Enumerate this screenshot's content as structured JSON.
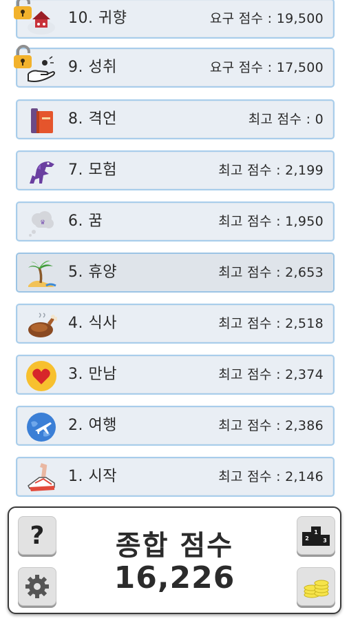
{
  "levels": [
    {
      "name": "10. 귀향",
      "score": "요구 점수 : 19,500",
      "locked": true,
      "icon": "home-return-icon"
    },
    {
      "name": "9. 성취",
      "score": "요구 점수 : 17,500",
      "locked": true,
      "icon": "hand-achievement-icon"
    },
    {
      "name": "8. 격언",
      "score": "최고 점수 : 0",
      "locked": false,
      "icon": "book-icon"
    },
    {
      "name": "7. 모험",
      "score": "최고 점수 : 2,199",
      "locked": false,
      "icon": "dragon-icon"
    },
    {
      "name": "6. 꿈",
      "score": "최고 점수 : 1,950",
      "locked": false,
      "icon": "dream-cloud-icon"
    },
    {
      "name": "5. 휴양",
      "score": "최고 점수 : 2,653",
      "locked": false,
      "icon": "palm-island-icon",
      "selected": true
    },
    {
      "name": "4. 식사",
      "score": "최고 점수 : 2,518",
      "locked": false,
      "icon": "roast-chicken-icon"
    },
    {
      "name": "3. 만남",
      "score": "최고 점수 : 2,374",
      "locked": false,
      "icon": "heart-icon"
    },
    {
      "name": "2. 여행",
      "score": "최고 점수 : 2,386",
      "locked": false,
      "icon": "globe-plane-icon"
    },
    {
      "name": "1. 시작",
      "score": "최고 점수 : 2,146",
      "locked": false,
      "icon": "running-shoe-icon"
    }
  ],
  "footer": {
    "total_label": "종합 점수",
    "total_value": "16,226",
    "help_glyph": "?",
    "help_icon": "help-icon",
    "settings_icon": "gear-icon",
    "leaderboard_icon": "podium-icon",
    "coins_icon": "coins-icon",
    "podium_labels": [
      "2",
      "1",
      "3"
    ]
  },
  "colors": {
    "card_bg": "#e9eef4",
    "card_border": "#a8cdeb",
    "text": "#2a2a2a"
  }
}
